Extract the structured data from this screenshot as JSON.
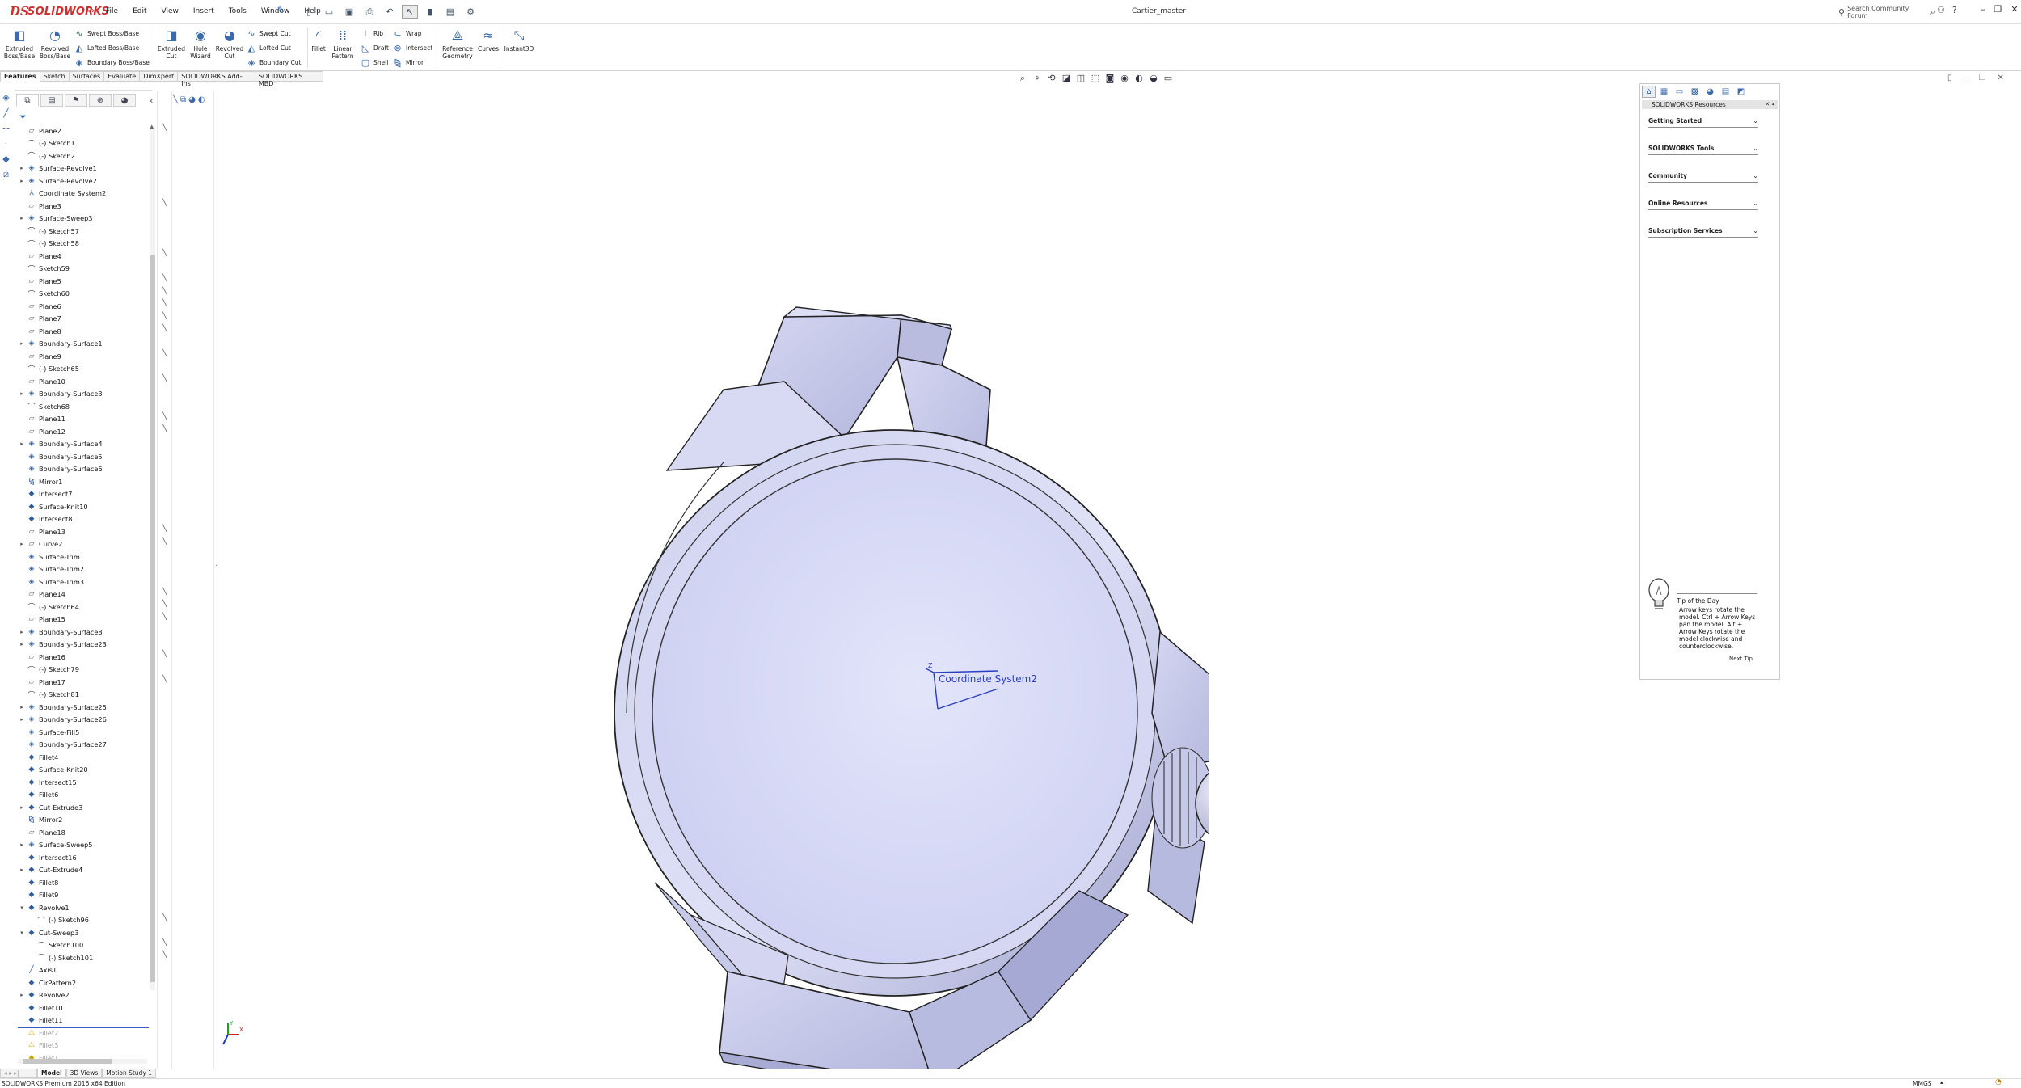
{
  "app": {
    "brand_ds": "DS",
    "brand_name": "SOLIDWORKS",
    "document_title": "Cartier_master",
    "search_placeholder": "Search Community Forum"
  },
  "menu": [
    "File",
    "Edit",
    "View",
    "Insert",
    "Tools",
    "Window",
    "Help"
  ],
  "ribbon": {
    "extruded_boss": "Extruded Boss/Base",
    "revolved_boss": "Revolved Boss/Base",
    "swept_boss": "Swept Boss/Base",
    "lofted_boss": "Lofted Boss/Base",
    "boundary_boss": "Boundary Boss/Base",
    "extruded_cut": "Extruded Cut",
    "hole_wizard": "Hole Wizard",
    "revolved_cut": "Revolved Cut",
    "swept_cut": "Swept Cut",
    "lofted_cut": "Lofted Cut",
    "boundary_cut": "Boundary Cut",
    "fillet": "Fillet",
    "linear_pattern": "Linear Pattern",
    "rib": "Rib",
    "draft": "Draft",
    "shell": "Shell",
    "wrap": "Wrap",
    "intersect": "Intersect",
    "mirror": "Mirror",
    "reference_geometry": "Reference Geometry",
    "curves": "Curves",
    "instant3d": "Instant3D"
  },
  "command_tabs": [
    "Features",
    "Sketch",
    "Surfaces",
    "Evaluate",
    "DimXpert",
    "SOLIDWORKS Add-Ins",
    "SOLIDWORKS MBD"
  ],
  "feature_tree": [
    {
      "label": "Plane2",
      "icon": "plane",
      "exp": ""
    },
    {
      "label": "(-) Sketch1",
      "icon": "sketch",
      "exp": ""
    },
    {
      "label": "(-) Sketch2",
      "icon": "sketch",
      "exp": ""
    },
    {
      "label": "Surface-Revolve1",
      "icon": "surface",
      "exp": "▸"
    },
    {
      "label": "Surface-Revolve2",
      "icon": "surface",
      "exp": "▸"
    },
    {
      "label": "Coordinate System2",
      "icon": "coord",
      "exp": ""
    },
    {
      "label": "Plane3",
      "icon": "plane",
      "exp": ""
    },
    {
      "label": "Surface-Sweep3",
      "icon": "surface",
      "exp": "▸"
    },
    {
      "label": "(-) Sketch57",
      "icon": "sketch",
      "exp": ""
    },
    {
      "label": "(-) Sketch58",
      "icon": "sketch",
      "exp": ""
    },
    {
      "label": "Plane4",
      "icon": "plane",
      "exp": ""
    },
    {
      "label": "Sketch59",
      "icon": "sketch",
      "exp": ""
    },
    {
      "label": "Plane5",
      "icon": "plane",
      "exp": ""
    },
    {
      "label": "Sketch60",
      "icon": "sketch",
      "exp": ""
    },
    {
      "label": "Plane6",
      "icon": "plane",
      "exp": ""
    },
    {
      "label": "Plane7",
      "icon": "plane",
      "exp": ""
    },
    {
      "label": "Plane8",
      "icon": "plane",
      "exp": ""
    },
    {
      "label": "Boundary-Surface1",
      "icon": "surface",
      "exp": "▸"
    },
    {
      "label": "Plane9",
      "icon": "plane",
      "exp": ""
    },
    {
      "label": "(-) Sketch65",
      "icon": "sketch",
      "exp": ""
    },
    {
      "label": "Plane10",
      "icon": "plane",
      "exp": ""
    },
    {
      "label": "Boundary-Surface3",
      "icon": "surface",
      "exp": "▸"
    },
    {
      "label": "Sketch68",
      "icon": "sketch",
      "exp": ""
    },
    {
      "label": "Plane11",
      "icon": "plane",
      "exp": ""
    },
    {
      "label": "Plane12",
      "icon": "plane",
      "exp": ""
    },
    {
      "label": "Boundary-Surface4",
      "icon": "surface",
      "exp": "▸"
    },
    {
      "label": "Boundary-Surface5",
      "icon": "surface",
      "exp": ""
    },
    {
      "label": "Boundary-Surface6",
      "icon": "surface",
      "exp": ""
    },
    {
      "label": "Mirror1",
      "icon": "mirror",
      "exp": ""
    },
    {
      "label": "Intersect7",
      "icon": "feature",
      "exp": ""
    },
    {
      "label": "Surface-Knit10",
      "icon": "feature",
      "exp": ""
    },
    {
      "label": "Intersect8",
      "icon": "feature",
      "exp": ""
    },
    {
      "label": "Plane13",
      "icon": "plane",
      "exp": ""
    },
    {
      "label": "Curve2",
      "icon": "plane",
      "exp": "▸"
    },
    {
      "label": "Surface-Trim1",
      "icon": "surface",
      "exp": ""
    },
    {
      "label": "Surface-Trim2",
      "icon": "surface",
      "exp": ""
    },
    {
      "label": "Surface-Trim3",
      "icon": "surface",
      "exp": ""
    },
    {
      "label": "Plane14",
      "icon": "plane",
      "exp": ""
    },
    {
      "label": "(-) Sketch64",
      "icon": "sketch",
      "exp": ""
    },
    {
      "label": "Plane15",
      "icon": "plane",
      "exp": ""
    },
    {
      "label": "Boundary-Surface8",
      "icon": "surface",
      "exp": "▸"
    },
    {
      "label": "Boundary-Surface23",
      "icon": "surface",
      "exp": "▸"
    },
    {
      "label": "Plane16",
      "icon": "plane",
      "exp": ""
    },
    {
      "label": "(-) Sketch79",
      "icon": "sketch",
      "exp": ""
    },
    {
      "label": "Plane17",
      "icon": "plane",
      "exp": ""
    },
    {
      "label": "(-) Sketch81",
      "icon": "sketch",
      "exp": ""
    },
    {
      "label": "Boundary-Surface25",
      "icon": "surface",
      "exp": "▸"
    },
    {
      "label": "Boundary-Surface26",
      "icon": "surface",
      "exp": "▸"
    },
    {
      "label": "Surface-Fill5",
      "icon": "surface",
      "exp": ""
    },
    {
      "label": "Boundary-Surface27",
      "icon": "surface",
      "exp": ""
    },
    {
      "label": "Fillet4",
      "icon": "feature",
      "exp": ""
    },
    {
      "label": "Surface-Knit20",
      "icon": "feature",
      "exp": ""
    },
    {
      "label": "Intersect15",
      "icon": "feature",
      "exp": ""
    },
    {
      "label": "Fillet6",
      "icon": "feature",
      "exp": ""
    },
    {
      "label": "Cut-Extrude3",
      "icon": "feature",
      "exp": "▸"
    },
    {
      "label": "Mirror2",
      "icon": "mirror",
      "exp": ""
    },
    {
      "label": "Plane18",
      "icon": "plane",
      "exp": ""
    },
    {
      "label": "Surface-Sweep5",
      "icon": "surface",
      "exp": "▸"
    },
    {
      "label": "Intersect16",
      "icon": "feature",
      "exp": ""
    },
    {
      "label": "Cut-Extrude4",
      "icon": "feature",
      "exp": "▸"
    },
    {
      "label": "Fillet8",
      "icon": "feature",
      "exp": ""
    },
    {
      "label": "Fillet9",
      "icon": "feature",
      "exp": ""
    },
    {
      "label": "Revolve1",
      "icon": "feature",
      "exp": "▾"
    },
    {
      "label": "(-) Sketch96",
      "icon": "sketch",
      "exp": "",
      "indent": true
    },
    {
      "label": "Cut-Sweep3",
      "icon": "feature",
      "exp": "▾"
    },
    {
      "label": "Sketch100",
      "icon": "sketch",
      "exp": "",
      "indent": true
    },
    {
      "label": "(-) Sketch101",
      "icon": "sketch",
      "exp": "",
      "indent": true
    },
    {
      "label": "Axis1",
      "icon": "axis",
      "exp": ""
    },
    {
      "label": "CirPattern2",
      "icon": "feature",
      "exp": ""
    },
    {
      "label": "Revolve2",
      "icon": "feature",
      "exp": "▸"
    },
    {
      "label": "Fillet10",
      "icon": "feature",
      "exp": ""
    },
    {
      "label": "Fillet11",
      "icon": "feature",
      "exp": ""
    },
    {
      "label": "Fillet2",
      "icon": "warning",
      "exp": "",
      "faded": true
    },
    {
      "label": "Fillet3",
      "icon": "warning",
      "exp": "",
      "faded": true
    },
    {
      "label": "Fillet1",
      "icon": "feature",
      "exp": "",
      "faded": true
    }
  ],
  "viewport": {
    "coordinate_label": "Coordinate System2",
    "triad_x": "X",
    "triad_y": "Y",
    "cs_z": "Z"
  },
  "task_pane": {
    "title": "SOLIDWORKS Resources",
    "sections": [
      "Getting Started",
      "SOLIDWORKS Tools",
      "Community",
      "Online Resources",
      "Subscription Services"
    ],
    "tip_title": "Tip of the Day",
    "tip_text": "Arrow keys rotate the model. Ctrl + Arrow Keys pan the model. Alt + Arrow Keys rotate the model clockwise and counterclockwise.",
    "next_tip": "Next Tip"
  },
  "bottom_tabs": [
    "Model",
    "3D Views",
    "Motion Study 1"
  ],
  "status": {
    "left": "SOLIDWORKS Premium 2016 x64 Edition",
    "units": "MMGS"
  }
}
